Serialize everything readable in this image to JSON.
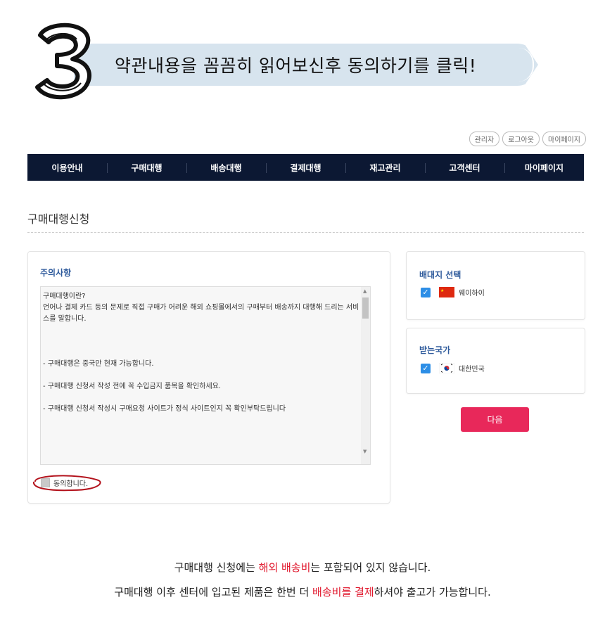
{
  "banner": {
    "step_number_icon": "number-3-icon",
    "text": "약관내용을 꼼꼼히 읽어보신후 동의하기를 클릭!"
  },
  "top_links": [
    "관리자",
    "로그아웃",
    "마이페이지"
  ],
  "nav": {
    "items": [
      "이용안내",
      "구매대행",
      "배송대행",
      "결제대행",
      "재고관리",
      "고객센터",
      "마이페이지"
    ],
    "background": "#0c1833"
  },
  "page_title": "구매대행신청",
  "notice": {
    "heading": "주의사항",
    "terms": [
      "구매대행이란?",
      "",
      "언어나 결제 카드 등의 문제로 직접 구매가 어려운 해외 쇼핑몰에서의 구매부터 배송까지 대행해 드리는 서비스를 말합니다.",
      "",
      "",
      "- 구매대행은 중국만 현재 가능합니다.",
      "",
      "- 구매대행 신청서 작성 전에 꼭 수입금지 품목을 확인하세요.",
      "",
      "- 구매대행 신청서 작성시 구매요청 사이트가 정식 사이트인지 꼭 확인부탁드립니다"
    ],
    "agree_label": "동의합니다."
  },
  "warehouse": {
    "heading": "배대지 선택",
    "option_label": "웨이하이",
    "checked": true,
    "flag_icon": "china-flag-icon"
  },
  "country": {
    "heading": "받는국가",
    "option_label": "대한민국",
    "checked": true,
    "flag_icon": "korea-flag-icon"
  },
  "next_button": "다음",
  "footer": {
    "line1": {
      "a": "구매대행 신청에는 ",
      "red": "해외 배송비",
      "b": "는 포함되어 있지 않습니다."
    },
    "line2": {
      "a": "구매대행 이후 센터에 입고된 제품은 한번 더 ",
      "red": "배송비를 결제",
      "b": "하셔야 출고가 가능합니다."
    }
  },
  "colors": {
    "accent_red": "#e0162b",
    "button_pink": "#e8285a",
    "checkbox_blue": "#2d8ee6",
    "heading_blue": "#2f5b9c",
    "banner_blue": "#d7e4ee",
    "annotation_circle": "#b3121c"
  }
}
